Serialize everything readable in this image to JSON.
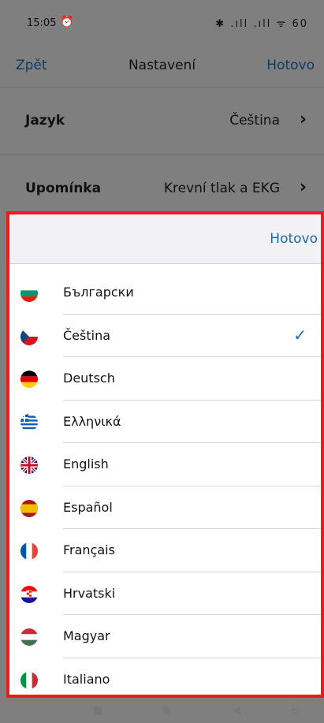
{
  "status": {
    "time": "15:05",
    "icons_text": "✱ .ıll .ıll ᯤ 60"
  },
  "nav": {
    "back": "Zpět",
    "title": "Nastavení",
    "done": "Hotovo"
  },
  "settings": [
    {
      "label": "Jazyk",
      "value": "Čeština"
    },
    {
      "label": "Upomínka",
      "value": "Krevní tlak a EKG"
    }
  ],
  "sheet": {
    "done": "Hotovo"
  },
  "languages": [
    {
      "name": "Български",
      "flag": "bulgaria",
      "selected": false
    },
    {
      "name": "Čeština",
      "flag": "czech",
      "selected": true
    },
    {
      "name": "Deutsch",
      "flag": "germany",
      "selected": false
    },
    {
      "name": "Ελληνικά",
      "flag": "greece",
      "selected": false
    },
    {
      "name": "English",
      "flag": "uk",
      "selected": false
    },
    {
      "name": "Español",
      "flag": "spain",
      "selected": false
    },
    {
      "name": "Français",
      "flag": "france",
      "selected": false
    },
    {
      "name": "Hrvatski",
      "flag": "croatia",
      "selected": false
    },
    {
      "name": "Magyar",
      "flag": "hungary",
      "selected": false
    },
    {
      "name": "Italiano",
      "flag": "italy",
      "selected": false
    }
  ],
  "check_mark": "✓",
  "colors": {
    "accent": "#1f6aa5",
    "highlight_border": "#ee1b1b"
  }
}
